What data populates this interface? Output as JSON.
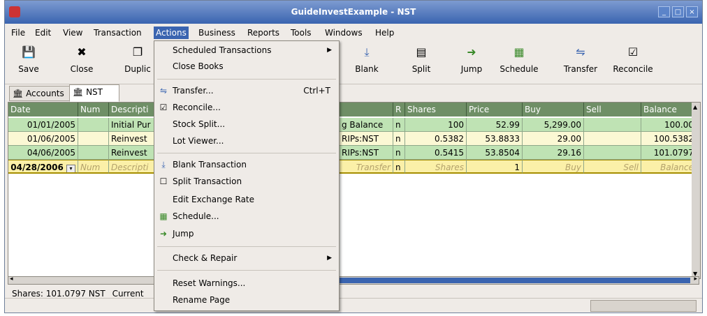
{
  "window": {
    "title": "GuideInvestExample - NST"
  },
  "menubar": {
    "items": [
      "File",
      "Edit",
      "View",
      "Transaction",
      "Actions",
      "Business",
      "Reports",
      "Tools",
      "Windows",
      "Help"
    ]
  },
  "toolbar": {
    "save": "Save",
    "close": "Close",
    "duplicate": "Duplic",
    "blank": "Blank",
    "split": "Split",
    "jump": "Jump",
    "schedule": "Schedule",
    "transfer": "Transfer",
    "reconcile": "Reconcile"
  },
  "tabs": {
    "accounts": "Accounts",
    "nst": "NST"
  },
  "register": {
    "columns": [
      "Date",
      "Num",
      "Descripti",
      "R",
      "Shares",
      "Price",
      "Buy",
      "Sell",
      "Balance"
    ],
    "rows": [
      {
        "date": "01/01/2005",
        "num": "",
        "desc": "Initial Pur",
        "transfer": "g Balance",
        "r": "n",
        "shares": "100",
        "price": "52.99",
        "buy": "5,299.00",
        "sell": "",
        "balance": "100.00"
      },
      {
        "date": "01/06/2005",
        "num": "",
        "desc": "Reinvest",
        "transfer": "RIPs:NST",
        "r": "n",
        "shares": "0.5382",
        "price": "53.8833",
        "buy": "29.00",
        "sell": "",
        "balance": "100.5382"
      },
      {
        "date": "04/06/2005",
        "num": "",
        "desc": "Reinvest",
        "transfer": "RIPs:NST",
        "r": "n",
        "shares": "0.5415",
        "price": "53.8504",
        "buy": "29.16",
        "sell": "",
        "balance": "101.0797"
      }
    ],
    "entry": {
      "date": "04/28/2006",
      "num": "Num",
      "desc": "Descripti",
      "transfer": "Transfer",
      "r": "n",
      "shares": "Shares",
      "price": "1",
      "buy": "Buy",
      "sell": "Sell",
      "balance": "Balance"
    }
  },
  "summary": {
    "shares": "Shares: 101.0797 NST",
    "current": "Current"
  },
  "actions_menu": {
    "scheduled": "Scheduled Transactions",
    "close_books": "Close Books",
    "transfer": "Transfer...",
    "transfer_accel": "Ctrl+T",
    "reconcile": "Reconcile...",
    "stock_split": "Stock Split...",
    "lot_viewer": "Lot Viewer...",
    "blank": "Blank Transaction",
    "split": "Split Transaction",
    "exchange": "Edit Exchange Rate",
    "schedule": "Schedule...",
    "jump": "Jump",
    "check_repair": "Check & Repair",
    "reset_warnings": "Reset Warnings...",
    "rename_page": "Rename Page"
  },
  "colors": {
    "titlebar": "#3a64b0",
    "register_header": "#6f8f66",
    "row_green": "#bfe3b4",
    "row_yellow": "#fbf8d4"
  }
}
